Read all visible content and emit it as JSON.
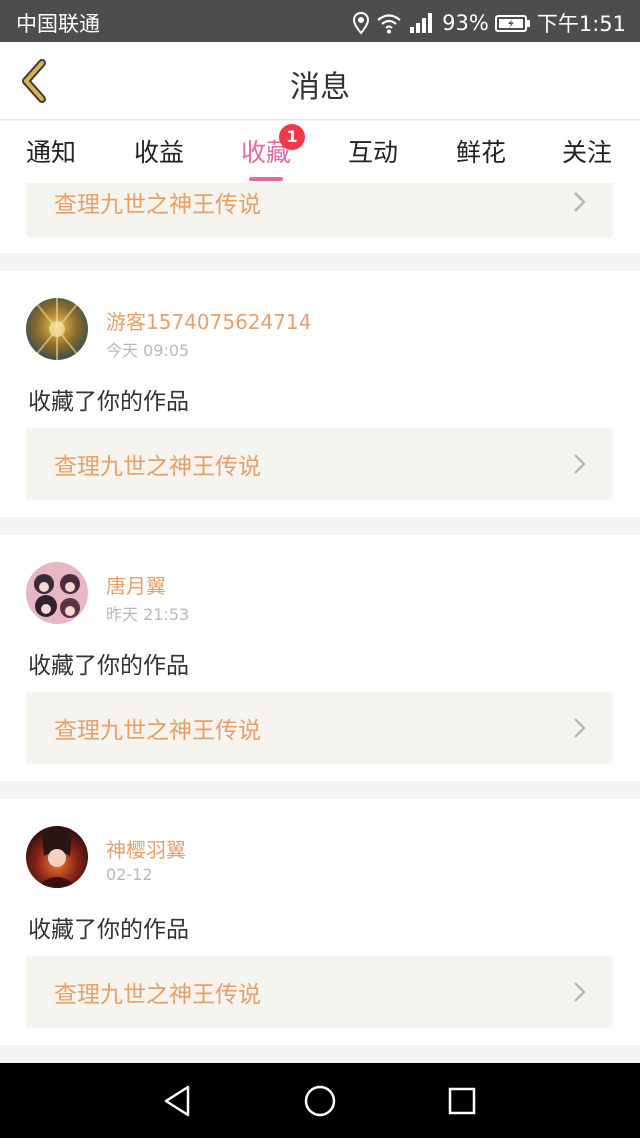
{
  "status": {
    "carrier": "中国联通",
    "battery": "93%",
    "time": "下午1:51",
    "icons": [
      "location-icon",
      "wifi-icon",
      "signal-icon",
      "battery-icon"
    ]
  },
  "header": {
    "title": "消息",
    "back_icon": "chevron-left-icon"
  },
  "tabs": [
    {
      "label": "通知"
    },
    {
      "label": "收益"
    },
    {
      "label": "收藏",
      "active": true,
      "badge": "1"
    },
    {
      "label": "互动"
    },
    {
      "label": "鲜花"
    },
    {
      "label": "关注"
    }
  ],
  "feed": {
    "partial_work_title": "查理九世之神王传说",
    "items": [
      {
        "user": "游客1574075624714",
        "time": "今天 09:05",
        "message": "收藏了你的作品",
        "work": "查理九世之神王传说"
      },
      {
        "user": "唐月翼",
        "time": "昨天 21:53",
        "message": "收藏了你的作品",
        "work": "查理九世之神王传说"
      },
      {
        "user": "神樱羽翼",
        "time": "02-12",
        "message": "收藏了你的作品",
        "work": "查理九世之神王传说"
      }
    ]
  },
  "colors": {
    "accent": "#e46aa6",
    "username": "#e8a06a",
    "badge": "#f03a4a",
    "back_arrow": "#d8b24a"
  },
  "navbar": {
    "icons": [
      "back-triangle-icon",
      "home-circle-icon",
      "recents-square-icon"
    ]
  }
}
